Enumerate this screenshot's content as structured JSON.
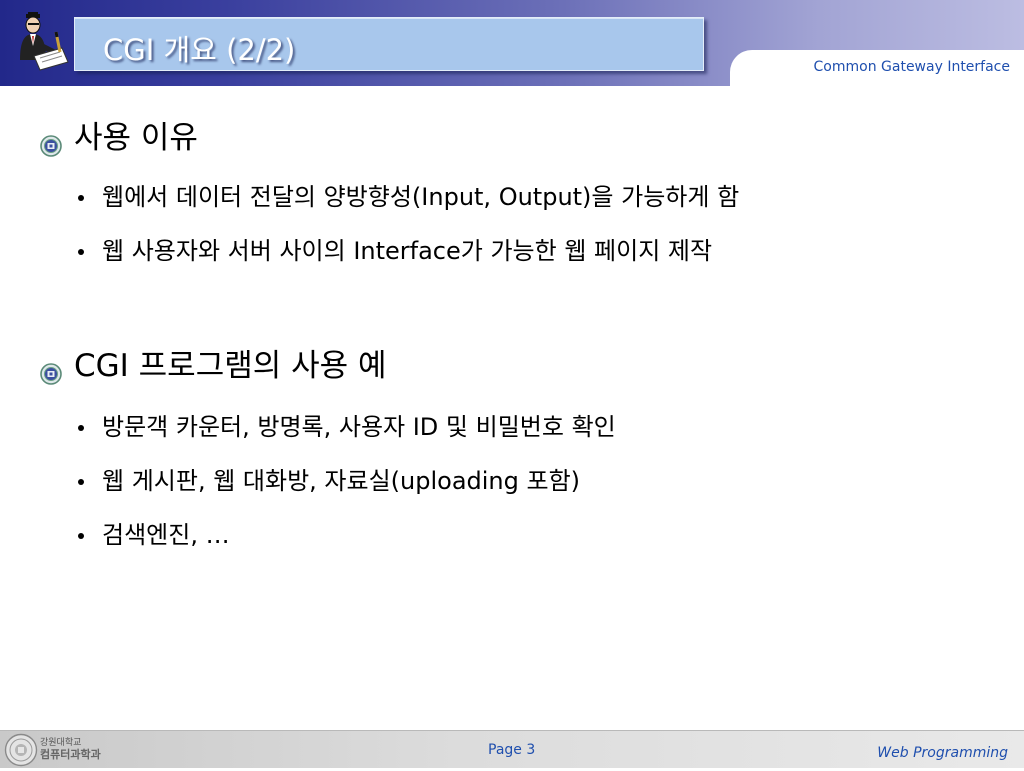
{
  "header": {
    "title": "CGI 개요 (2/2)",
    "subtitle": "Common Gateway Interface"
  },
  "sections": [
    {
      "heading": "사용 이유",
      "bullets": [
        "웹에서 데이터 전달의 양방향성(Input, Output)을 가능하게 함",
        "웹 사용자와 서버 사이의 Interface가 가능한 웹 페이지 제작"
      ]
    },
    {
      "heading": "CGI 프로그램의 사용 예",
      "bullets": [
        "방문객 카운터, 방명록, 사용자 ID 및 비밀번호 확인",
        "웹 게시판, 웹 대화방, 자료실(uploading 포함)",
        "검색엔진, …"
      ]
    }
  ],
  "footer": {
    "dept_line1": "강원대학교",
    "dept_line2": "컴퓨터과학과",
    "page": "Page 3",
    "course": "Web Programming"
  },
  "colors": {
    "header_start": "#22288a",
    "header_end": "#bcbde2",
    "title_box": "#a8c7ec",
    "accent_text": "#1f4fae"
  },
  "icons": {
    "header_logo": "professor-reading-icon",
    "section_bullet": "university-emblem-icon",
    "footer_logo": "university-seal-icon"
  }
}
